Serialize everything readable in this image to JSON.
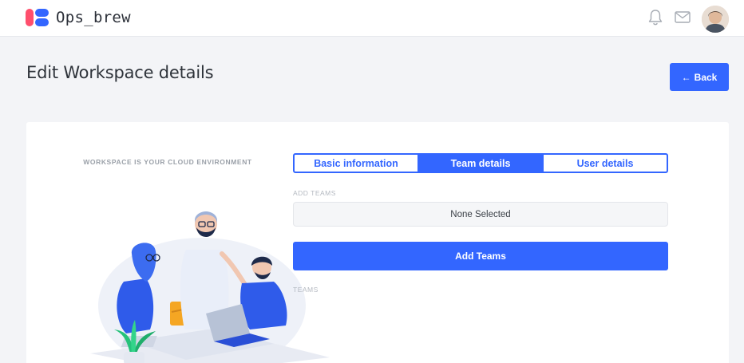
{
  "header": {
    "brand_name": "Ops_brew",
    "icons": [
      "notification-bell-icon",
      "mail-icon"
    ],
    "avatar": "user-avatar"
  },
  "page": {
    "title": "Edit Workspace details",
    "back_label": "Back",
    "back_icon": "arrow-left-icon"
  },
  "card": {
    "caption": "WORKSPACE IS YOUR CLOUD ENVIRONMENT",
    "tabs": [
      {
        "label": "Basic information",
        "active": false
      },
      {
        "label": "Team details",
        "active": true
      },
      {
        "label": "User details",
        "active": false
      }
    ],
    "add_teams_label": "ADD TEAMS",
    "teams_select_value": "None Selected",
    "add_teams_button": "Add Teams",
    "teams_label": "TEAMS"
  },
  "colors": {
    "accent": "#3366ff",
    "logo_red": "#ff4f6d",
    "background": "#f3f4f7"
  }
}
